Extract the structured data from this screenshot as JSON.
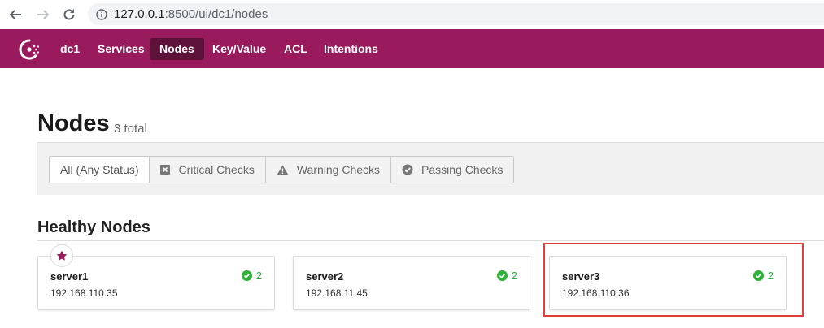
{
  "browser": {
    "url_host": "127.0.0.1",
    "url_rest": ":8500/ui/dc1/nodes"
  },
  "topnav": {
    "items": [
      {
        "label": "dc1"
      },
      {
        "label": "Services"
      },
      {
        "label": "Nodes",
        "active": true
      },
      {
        "label": "Key/Value"
      },
      {
        "label": "ACL"
      },
      {
        "label": "Intentions"
      }
    ]
  },
  "page": {
    "title": "Nodes",
    "count": "3 total"
  },
  "filters": {
    "buttons": [
      {
        "label": "All (Any Status)",
        "icon": null,
        "selected": true
      },
      {
        "label": "Critical Checks",
        "icon": "critical-icon"
      },
      {
        "label": "Warning Checks",
        "icon": "warning-icon"
      },
      {
        "label": "Passing Checks",
        "icon": "passing-icon"
      }
    ]
  },
  "section": {
    "title": "Healthy Nodes"
  },
  "nodes": [
    {
      "name": "server1",
      "ip": "192.168.110.35",
      "checks": "2",
      "leader": true
    },
    {
      "name": "server2",
      "ip": "192.168.11.45",
      "checks": "2",
      "leader": false
    },
    {
      "name": "server3",
      "ip": "192.168.110.36",
      "checks": "2",
      "leader": false
    }
  ],
  "colors": {
    "brand": "#9a1b5d",
    "nav_active": "#5f1239",
    "passing": "#2eb039",
    "highlight": "#e03c3c"
  }
}
